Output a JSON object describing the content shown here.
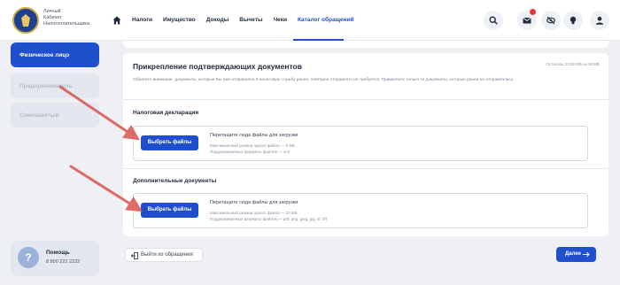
{
  "header": {
    "brand": [
      "Личный",
      "Кабинет",
      "Налогоплательщика"
    ],
    "nav": [
      {
        "label": "Налоги"
      },
      {
        "label": "Имущество"
      },
      {
        "label": "Доходы"
      },
      {
        "label": "Вычеты"
      },
      {
        "label": "Чеки"
      },
      {
        "label": "Каталог обращений",
        "active": true
      }
    ],
    "icons": [
      "search-icon",
      "mail-icon",
      "eye-off-icon",
      "lightbulb-icon",
      "user-icon"
    ]
  },
  "sidebar": {
    "items": [
      {
        "label": "Физическое лицо",
        "active": true
      },
      {
        "label": "Предприниматель",
        "active": false
      },
      {
        "label": "Самозанятый",
        "active": false
      }
    ],
    "help": {
      "title": "Помощь",
      "phone": "8 800 222 2222"
    }
  },
  "card": {
    "title": "Прикрепление подтверждающих документов",
    "timer": "Осталось 22:00 МБ из 20 МБ",
    "note": "Обратите внимание, документы, которые Вы уже отправляли в налоговую службу ранее, повторно отправлять не требуется. Прикрепите только те документы, которые ранее не отправлялись.",
    "sections": [
      {
        "title": "Налоговая декларация",
        "button": "Выбрать файлы",
        "drop_text": "Перетащите сюда файлы для загрузки",
        "limit": "Максимальный размер одного файла — 5 МБ",
        "formats": "Поддерживаемые форматы файлов — xml"
      },
      {
        "title": "Дополнительные документы",
        "button": "Выбрать файлы",
        "drop_text": "Перетащите сюда файлы для загрузки",
        "limit": "Максимальный размер одного файла — 10 МБ",
        "formats": "Поддерживаемые форматы файлов — pdf, png, jpeg, jpg, tif, tiff"
      }
    ]
  },
  "footer": {
    "exit_label": "Выйти из обращения",
    "next_label": "Далее"
  },
  "colors": {
    "accent": "#1f4fcc",
    "annotation_arrow": "#d9534f"
  }
}
